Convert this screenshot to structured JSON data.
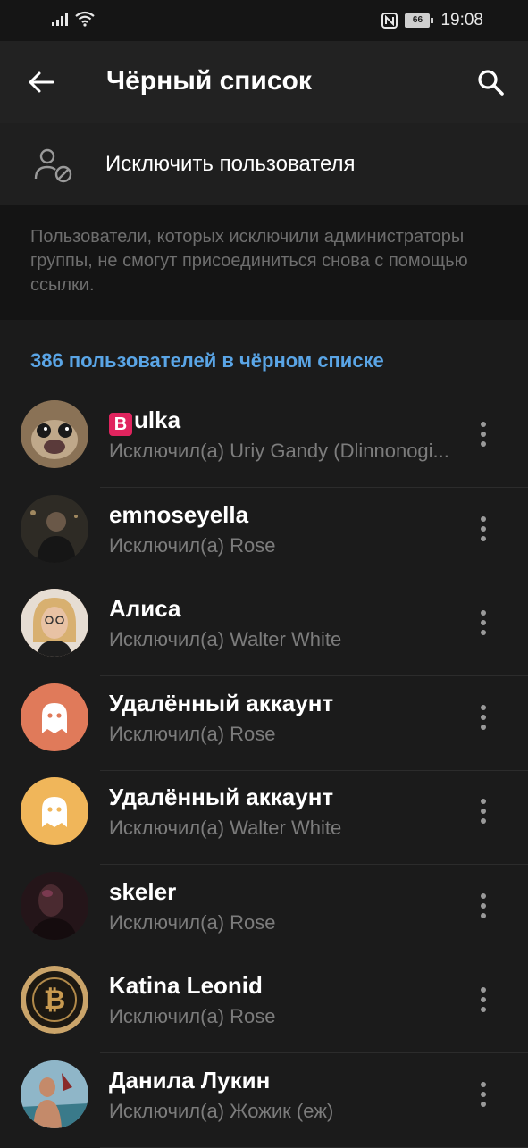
{
  "status_bar": {
    "time": "19:08",
    "battery": "66",
    "icons": [
      "signal-icon",
      "wifi-icon",
      "nfc-icon",
      "battery-icon"
    ]
  },
  "app_bar": {
    "title": "Чёрный список",
    "back_icon": "back-arrow-icon",
    "search_icon": "search-icon"
  },
  "action": {
    "label": "Исключить пользователя",
    "icon": "user-block-icon"
  },
  "info": {
    "text": "Пользователи, которых исключили администраторы группы, не смогут присоединиться снова с помощью ссылки."
  },
  "list": {
    "header": "386 пользователей в чёрном списке",
    "items": [
      {
        "badge": "B",
        "name": "ulka",
        "subtitle": "Исключил(а) Uriy Gandy (Dlinnonogi...",
        "avatar": "photo",
        "color": "#6b5a44"
      },
      {
        "name": "emnoseyella",
        "subtitle": "Исключил(а) Rose",
        "avatar": "photo",
        "color": "#2a2a26"
      },
      {
        "name": "Алиса",
        "subtitle": "Исключил(а) Walter White",
        "avatar": "photo",
        "color": "#c9a58a"
      },
      {
        "name": "Удалённый аккаунт",
        "subtitle": "Исключил(а) Rose",
        "avatar": "ghost",
        "color": "#e07a5a"
      },
      {
        "name": "Удалённый аккаунт",
        "subtitle": "Исключил(а) Walter White",
        "avatar": "ghost",
        "color": "#f0b65a"
      },
      {
        "name": "skeler",
        "subtitle": "Исключил(а) Rose",
        "avatar": "photo",
        "color": "#2a1a1e"
      },
      {
        "name": "Katina Leonid",
        "subtitle": "Исключил(а) Rose",
        "avatar": "bitcoin",
        "color": "#1b1710"
      },
      {
        "name": "Данила Лукин",
        "subtitle": "Исключил(а) Жожик (еж)",
        "avatar": "photo",
        "color": "#7aa0b2"
      }
    ]
  },
  "colors": {
    "accent": "#5aa5e6",
    "background": "#1b1b1b",
    "ghost_orange": "#e07a5a",
    "ghost_yellow": "#f0b65a"
  }
}
